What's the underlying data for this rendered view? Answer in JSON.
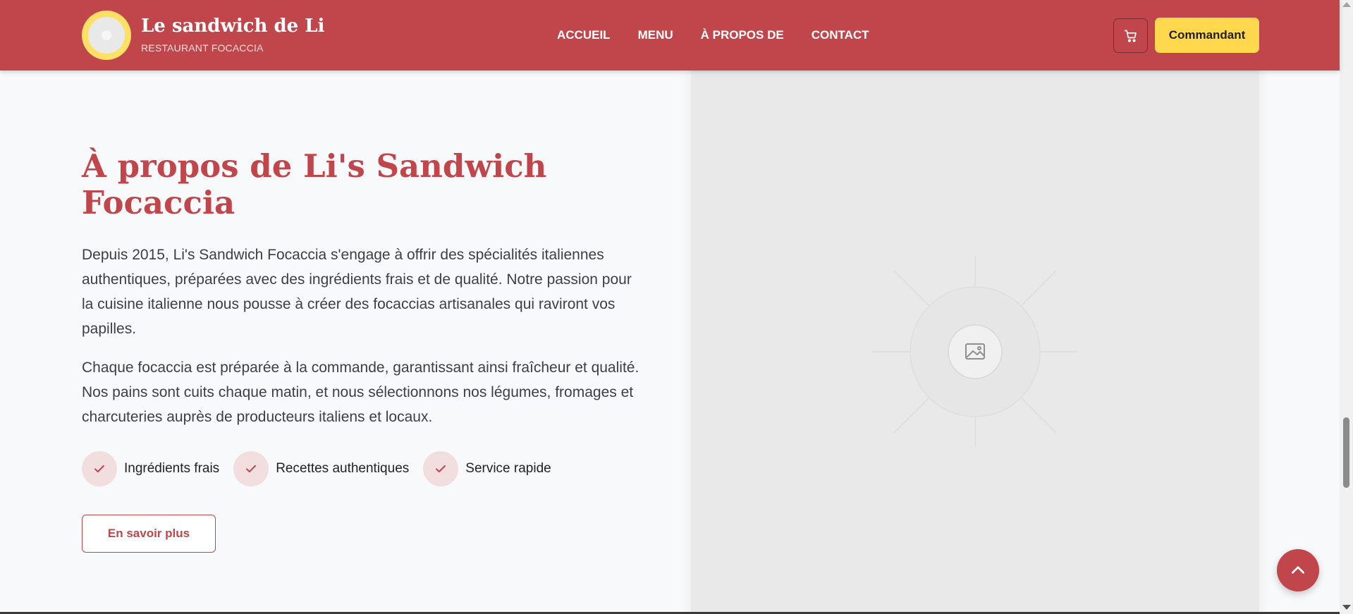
{
  "header": {
    "brand_title": "Le sandwich de Li",
    "brand_subtitle": "RESTAURANT FOCACCIA",
    "logo_icon": "focaccia-logo-icon",
    "nav": [
      {
        "label": "ACCUEIL"
      },
      {
        "label": "MENU"
      },
      {
        "label": "À PROPOS DE"
      },
      {
        "label": "CONTACT"
      }
    ],
    "cart_icon": "shopping-cart-icon",
    "order_button": "Commandant"
  },
  "about": {
    "title": "À propos de Li's Sandwich Focaccia",
    "paragraph_1": "Depuis 2015, Li's Sandwich Focaccia s'engage à offrir des spécialités italiennes authentiques, préparées avec des ingrédients frais et de qualité. Notre passion pour la cuisine italienne nous pousse à créer des focaccias artisanales qui raviront vos papilles.",
    "paragraph_2": "Chaque focaccia est préparée à la commande, garantissant ainsi fraîcheur et qualité. Nos pains sont cuits chaque matin, et nous sélectionnons nos légumes, fromages et charcuteries auprès de producteurs italiens et locaux.",
    "features": [
      {
        "label": "Ingrédients frais",
        "icon": "check-icon"
      },
      {
        "label": "Recettes authentiques",
        "icon": "check-icon"
      },
      {
        "label": "Service rapide",
        "icon": "check-icon"
      }
    ],
    "learn_more_button": "En savoir plus",
    "image_placeholder_icon": "image-placeholder-icon"
  },
  "scroll_top_icon": "chevron-up-icon",
  "colors": {
    "primary": "#c1464b",
    "accent": "#ffd84d",
    "page_background": "#f8f9fa",
    "image_panel": "#e9e9e9",
    "text": "#3b3f46"
  }
}
